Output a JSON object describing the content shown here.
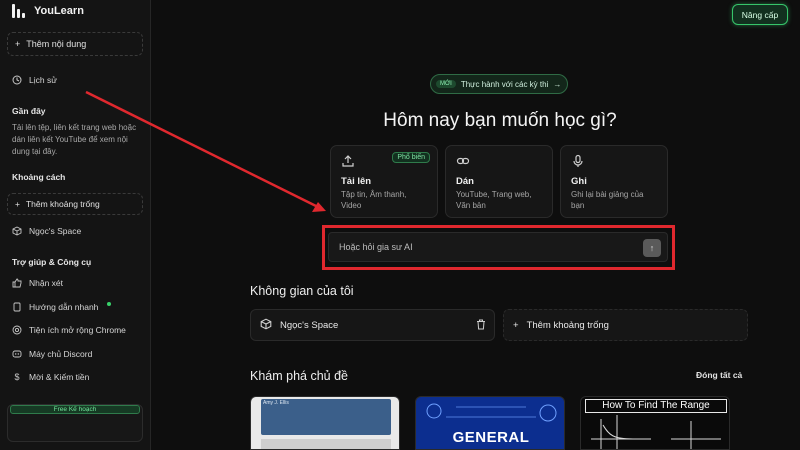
{
  "app": {
    "name": "YouLearn"
  },
  "sidebar": {
    "add_content": "Thêm nội dung",
    "history": "Lịch sử",
    "recent_heading": "Gần đây",
    "recent_desc": "Tải lên tệp, liên kết trang web hoặc dán liên kết YouTube để xem nội dung tại đây.",
    "spaces_heading": "Khoảng cách",
    "add_space": "Thêm khoảng trống",
    "space_item": "Ngọc's Space",
    "help_heading": "Trợ giúp & Công cụ",
    "help_items": [
      "Nhận xét",
      "Hướng dẫn nhanh",
      "Tiện ích mở rộng Chrome",
      "Máy chủ Discord",
      "Mời & Kiếm tiền"
    ],
    "plan_tag": "Free Kế hoạch"
  },
  "header": {
    "upgrade": "Nâng cấp"
  },
  "main": {
    "pill_badge": "MỚI",
    "pill_text": "Thực hành với các kỳ thi",
    "hero_title": "Hôm nay bạn muốn học gì?",
    "cards": [
      {
        "title": "Tải lên",
        "desc": "Tập tin, Âm thanh, Video",
        "badge": "Phổ biến"
      },
      {
        "title": "Dán",
        "desc": "YouTube, Trang web, Văn bản"
      },
      {
        "title": "Ghi",
        "desc": "Ghi lại bài giảng của bạn"
      }
    ],
    "ask_placeholder": "Hoặc hỏi gia sư AI",
    "my_space_title": "Không gian của tôi",
    "space_name": "Ngọc's Space",
    "add_space": "Thêm khoảng trống",
    "explore_title": "Khám phá chủ đề",
    "close_all": "Đóng tất cả",
    "thumbnails": [
      {
        "label": "Amy J. Ellis"
      },
      {
        "label": "GENERAL CHEMISTRY"
      },
      {
        "label": "How To Find The Range"
      }
    ]
  },
  "colors": {
    "accent": "#36c46a",
    "highlight": "#e0282e",
    "background": "#0e0e0e"
  }
}
